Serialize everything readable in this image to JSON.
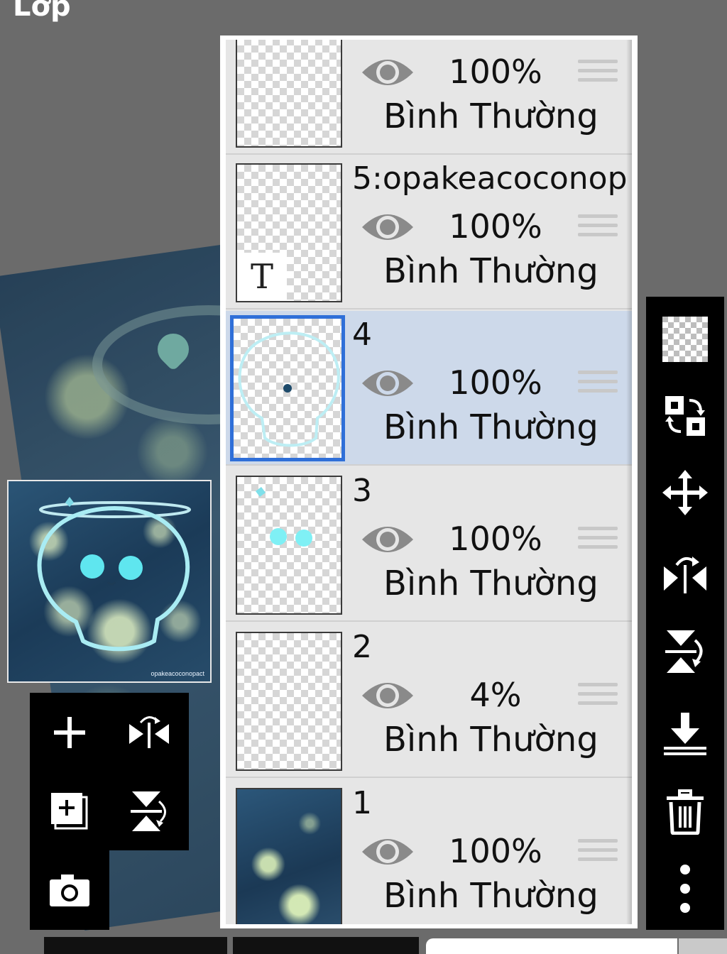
{
  "app": {
    "title": "Lớp"
  },
  "colors": {
    "accent": "#2f6fd8",
    "selected_row": "#cdd9ea",
    "row_bg": "#e6e6e6",
    "eye_color": "#8a8a8a",
    "toolbar_bg": "#000000",
    "background": "#6b6b6b"
  },
  "preview": {
    "caption": "opakeacoconopact"
  },
  "layers": [
    {
      "name": "",
      "opacity": "100%",
      "blend": "Bình Thường",
      "visible": true,
      "selected": false,
      "thumb": "empty"
    },
    {
      "name": "5:opakeacoconop",
      "opacity": "100%",
      "blend": "Bình Thường",
      "visible": true,
      "selected": false,
      "thumb": "text",
      "thumb_badge": "T"
    },
    {
      "name": "4",
      "opacity": "100%",
      "blend": "Bình Thường",
      "visible": true,
      "selected": true,
      "thumb": "mushroom-outline"
    },
    {
      "name": "3",
      "opacity": "100%",
      "blend": "Bình Thường",
      "visible": true,
      "selected": false,
      "thumb": "eyes"
    },
    {
      "name": "2",
      "opacity": "4%",
      "blend": "Bình Thường",
      "visible": true,
      "selected": false,
      "thumb": "empty"
    },
    {
      "name": "1",
      "opacity": "100%",
      "blend": "Bình Thường",
      "visible": true,
      "selected": false,
      "thumb": "background-art"
    }
  ],
  "left_tools": [
    {
      "icon": "plus-icon",
      "action": "add-layer"
    },
    {
      "icon": "flip-horizontal-icon",
      "action": "flip-horizontal"
    },
    {
      "icon": "add-layer-copy-icon",
      "action": "add-layer-copy"
    },
    {
      "icon": "flip-vertical-icon",
      "action": "flip-vertical"
    },
    {
      "icon": "camera-icon",
      "action": "import-photo"
    }
  ],
  "right_tools": [
    {
      "icon": "transparency-icon",
      "action": "clear-layer"
    },
    {
      "icon": "swap-icon",
      "action": "swap"
    },
    {
      "icon": "move-icon",
      "action": "move"
    },
    {
      "icon": "flip-horizontal-icon",
      "action": "flip-horizontal"
    },
    {
      "icon": "flip-vertical-icon",
      "action": "flip-vertical"
    },
    {
      "icon": "merge-down-icon",
      "action": "merge-down"
    },
    {
      "icon": "trash-icon",
      "action": "delete-layer"
    },
    {
      "icon": "more-icon",
      "action": "more"
    }
  ]
}
